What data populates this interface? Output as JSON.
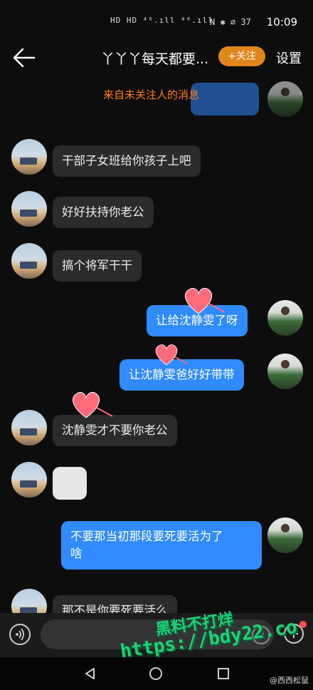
{
  "status_bar": {
    "left_indicators": "HD HD ⁴⁶.ıll ⁴⁶.ıll",
    "right_indicators": "N ✱ ⌀ 37",
    "time": "10:09"
  },
  "header": {
    "title": "丫丫丫每天都要...",
    "follow_label": "+关注",
    "settings_label": "设置"
  },
  "stranger_notice": "来自未关注人的消息",
  "messages": [
    {
      "dir": "in",
      "text": "干部子女班给你孩子上吧"
    },
    {
      "dir": "in",
      "text": "好好扶持你老公"
    },
    {
      "dir": "in",
      "text": "搞个将军干干"
    },
    {
      "dir": "out",
      "text": "让给沈静雯了呀"
    },
    {
      "dir": "out",
      "text": "让沈静雯爸好好带带"
    },
    {
      "dir": "in",
      "text": "沈静雯才不要你老公"
    },
    {
      "dir": "in",
      "text": ""
    },
    {
      "dir": "out",
      "text": "不要那当初那段要死要活为了\n啥"
    },
    {
      "dir": "in",
      "text": "那不是你要死要活么"
    }
  ],
  "input": {
    "placeholder": ""
  },
  "watermark": {
    "title": "黑料不打烊",
    "url": "https://bdy22.co",
    "weibo": "@西西松鼠"
  },
  "colors": {
    "background": "#0d0d0d",
    "outgoing_bubble": "#2f8bff",
    "incoming_bubble": "#2b2b2b",
    "follow_button": "#e0861a",
    "notice_text": "#ff7a1a",
    "heart": "#ff6b7a"
  },
  "icons": {
    "back": "arrow-left",
    "voice": "voice-wave",
    "emoji": "smiley-face",
    "more": "plus-circle",
    "nav_back": "triangle-left",
    "nav_home": "circle",
    "nav_recent": "square"
  }
}
